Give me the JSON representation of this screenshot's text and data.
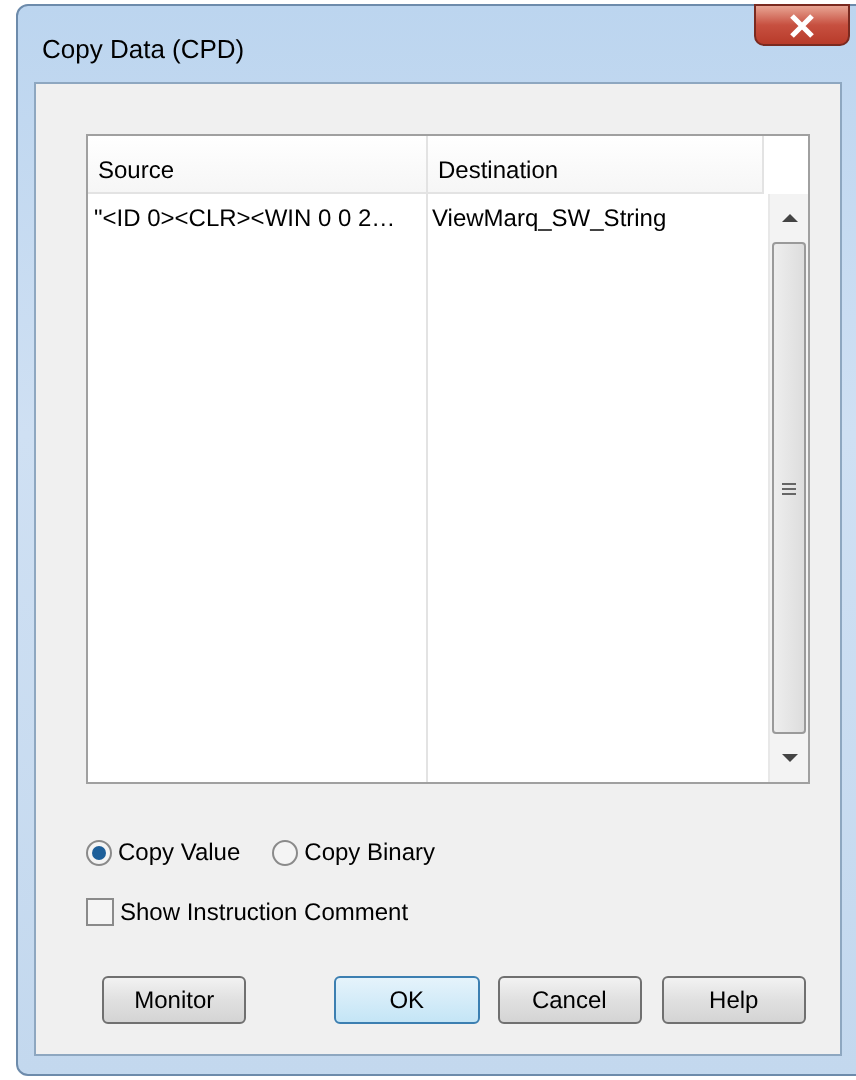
{
  "window": {
    "title": "Copy Data (CPD)"
  },
  "table": {
    "columns": [
      "Source",
      "Destination"
    ],
    "rows": [
      [
        "\"<ID 0><CLR><WIN 0 0 2…",
        "ViewMarq_SW_String"
      ]
    ]
  },
  "copy_mode": [
    {
      "label": "Copy Value",
      "selected": true
    },
    {
      "label": "Copy Binary",
      "selected": false
    }
  ],
  "show_instruction_comment": {
    "label": "Show Instruction Comment",
    "checked": false
  },
  "buttons": [
    {
      "label": "Monitor",
      "default": false
    },
    {
      "label": "OK",
      "default": true
    },
    {
      "label": "Cancel",
      "default": false
    },
    {
      "label": "Help",
      "default": false
    }
  ]
}
